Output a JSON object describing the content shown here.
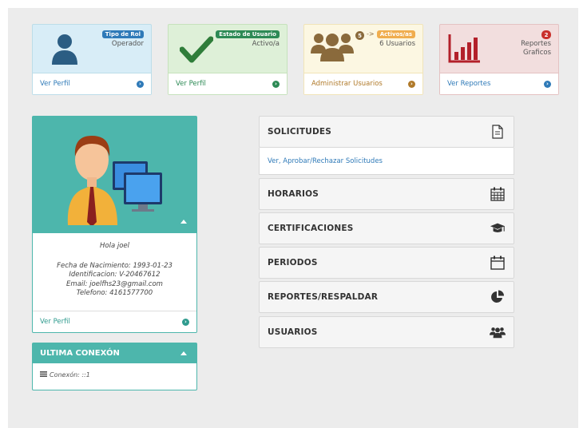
{
  "cards": [
    {
      "badge": "Tipo de Rol",
      "text": [
        "Operador"
      ],
      "link": "Ver Perfil",
      "icon": "user-icon",
      "badge_color": "#2f7ab8"
    },
    {
      "badge": "Estado de Usuario",
      "text": [
        "Activo/a"
      ],
      "link": "Ver Perfil",
      "icon": "checkmark-icon",
      "badge_color": "#2d8a55"
    },
    {
      "count": "5",
      "arrow": "->",
      "badge": "Activos/as",
      "text": [
        "6 Usuarios"
      ],
      "link": "Administrar Usuarios",
      "icon": "group-icon",
      "badge_color": "#f0ad4e"
    },
    {
      "count": "2",
      "text": [
        "Reportes",
        "Graficos"
      ],
      "link": "Ver Reportes",
      "icon": "bar-chart-icon",
      "badge_color": "#c9302c"
    }
  ],
  "profile": {
    "greeting": "Hola joel",
    "birth": "Fecha de Nacimiento: 1993-01-23",
    "id": "Identificacion: V-20467612",
    "email": "Email: joelfhs23@gmail.com",
    "phone": "Telefono: 4161577700",
    "link": "Ver Perfil"
  },
  "last_connection": {
    "title": "ULTIMA CONEXÓN",
    "text": "Conexón: ::1"
  },
  "menu": [
    {
      "label": "SOLICITUDES",
      "icon": "document-icon",
      "sub": "Ver, Aprobar/Rechazar Solicitudes"
    },
    {
      "label": "HORARIOS",
      "icon": "calendar-grid-icon"
    },
    {
      "label": "CERTIFICACIONES",
      "icon": "graduation-cap-icon"
    },
    {
      "label": "PERIODOS",
      "icon": "calendar-icon"
    },
    {
      "label": "REPORTES/RESPALDAR",
      "icon": "pie-chart-icon"
    },
    {
      "label": "USUARIOS",
      "icon": "users-icon"
    }
  ],
  "colors": {
    "teal": "#4db6ac",
    "blue": "#2f7ab8",
    "green": "#2d8a55",
    "orange": "#f0ad4e",
    "red": "#c9302c"
  }
}
